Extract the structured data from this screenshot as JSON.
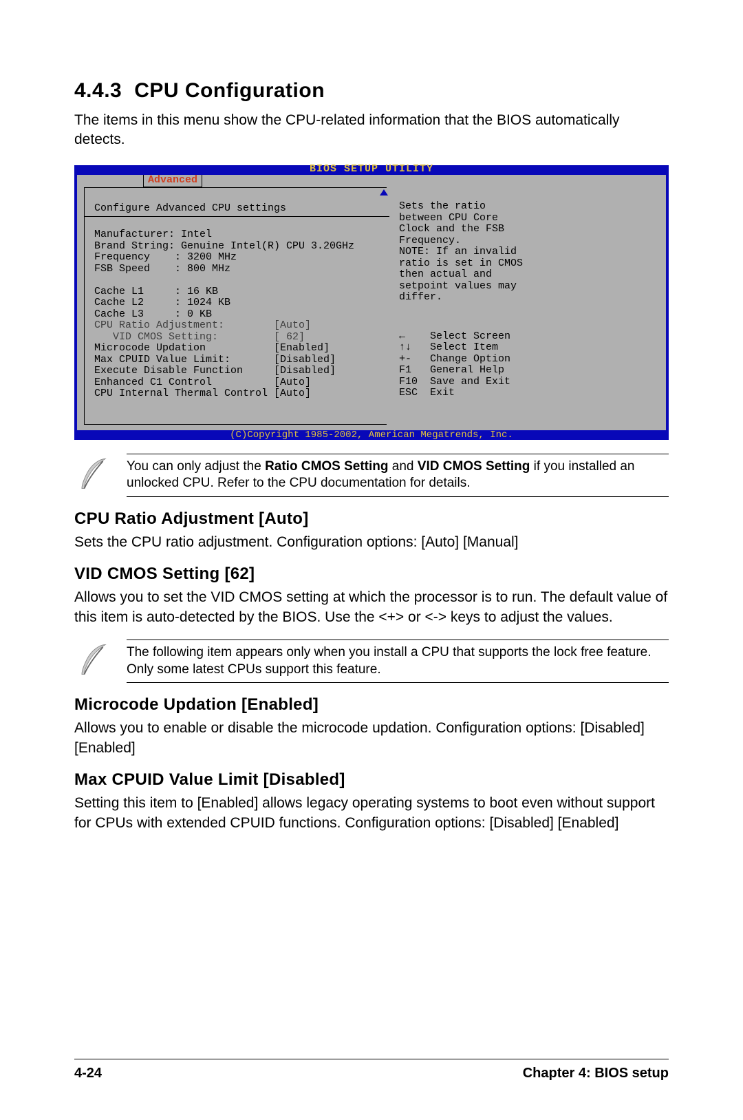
{
  "section": {
    "number": "4.4.3",
    "title": "CPU Configuration"
  },
  "intro": "The items in this menu show the CPU-related information that the BIOS automatically detects.",
  "bios": {
    "title": "BIOS SETUP UTILITY",
    "tab": "Advanced",
    "left_header": "Configure Advanced CPU settings",
    "info": {
      "manufacturer": "Manufacturer: Intel",
      "brand": "Brand String: Genuine Intel(R) CPU 3.20GHz",
      "frequency": "Frequency    : 3200 MHz",
      "fsb": "FSB Speed    : 800 MHz",
      "l1": "Cache L1     : 16 KB",
      "l2": "Cache L2     : 1024 KB",
      "l3": "Cache L3     : 0 KB"
    },
    "settings": [
      {
        "label": "CPU Ratio Adjustment:",
        "value": "[Auto]",
        "dim": true
      },
      {
        "label": "   VID CMOS Setting:",
        "value": "[ 62]",
        "dim": true
      },
      {
        "label": "Microcode Updation",
        "value": "[Enabled]",
        "dim": false
      },
      {
        "label": "Max CPUID Value Limit:",
        "value": "[Disabled]",
        "dim": false
      },
      {
        "label": "Execute Disable Function",
        "value": "[Disabled]",
        "dim": false
      },
      {
        "label": "Enhanced C1 Control",
        "value": "[Auto]",
        "dim": false
      },
      {
        "label": "CPU Internal Thermal Control",
        "value": "[Auto]",
        "dim": false
      }
    ],
    "help": "Sets the ratio\nbetween CPU Core\nClock and the FSB\nFrequency.\nNOTE: If an invalid\nratio is set in CMOS\nthen actual and\nsetpoint values may\ndiffer.",
    "nav": [
      {
        "key": "←",
        "label": "Select Screen"
      },
      {
        "key": "↑↓",
        "label": "Select Item"
      },
      {
        "key": "+-",
        "label": "Change Option"
      },
      {
        "key": "F1",
        "label": "General Help"
      },
      {
        "key": "F10",
        "label": "Save and Exit"
      },
      {
        "key": "ESC",
        "label": "Exit"
      }
    ],
    "copyright": "(C)Copyright 1985-2002, American Megatrends, Inc."
  },
  "note1": {
    "pre": "You can only adjust the ",
    "b1": "Ratio CMOS Setting",
    "mid": " and ",
    "b2": "VID CMOS Setting",
    "post": " if you installed an unlocked CPU. Refer to the CPU documentation for details."
  },
  "items": {
    "cpu_ratio": {
      "head": "CPU Ratio Adjustment [Auto]",
      "body": "Sets the CPU ratio adjustment. Configuration options: [Auto] [Manual]"
    },
    "vid": {
      "head": "VID CMOS Setting [62]",
      "body": "Allows you to set the VID CMOS setting at which the processor is to run. The default value of this item is auto-detected by the BIOS. Use the <+> or <-> keys to adjust the values."
    },
    "note2": "The following item appears only when you install a CPU that supports the lock free feature. Only some latest CPUs support this feature.",
    "microcode": {
      "head": "Microcode Updation [Enabled]",
      "body": "Allows you to enable or disable the microcode updation. Configuration options: [Disabled] [Enabled]"
    },
    "maxcpuid": {
      "head": "Max CPUID Value Limit [Disabled]",
      "body": "Setting this item to [Enabled] allows legacy operating systems to boot even without support for CPUs with extended CPUID functions. Configuration options: [Disabled] [Enabled]"
    }
  },
  "footer": {
    "left": "4-24",
    "right": "Chapter 4: BIOS setup"
  }
}
